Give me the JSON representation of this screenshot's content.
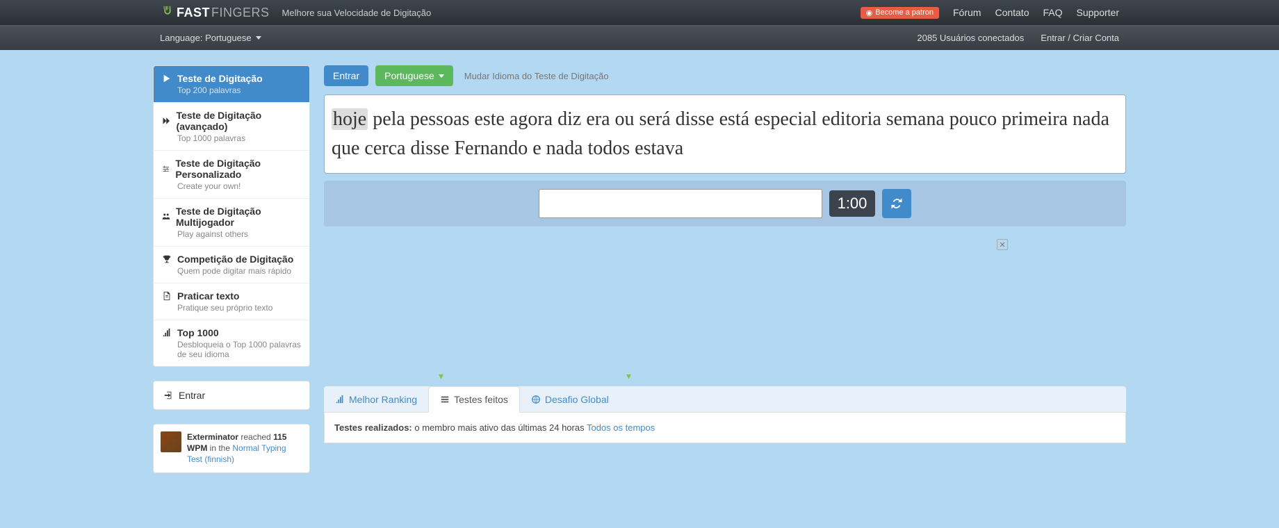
{
  "header": {
    "logo_bold": "FAST",
    "logo_thin": "FINGERS",
    "tagline": "Melhore sua Velocidade de Digitação",
    "patron": "Become a patron",
    "nav": {
      "forum": "Fórum",
      "contato": "Contato",
      "faq": "FAQ",
      "supporter": "Supporter"
    }
  },
  "subheader": {
    "language_label": "Language: Portuguese",
    "users_online": "2085 Usuários conectados",
    "login": "Entrar / Criar Conta"
  },
  "sidebar": {
    "items": [
      {
        "title": "Teste de Digitação",
        "sub": "Top 200 palavras"
      },
      {
        "title": "Teste de Digitação (avançado)",
        "sub": "Top 1000 palavras"
      },
      {
        "title": "Teste de Digitação Personalizado",
        "sub": "Create your own!"
      },
      {
        "title": "Teste de Digitação Multijogador",
        "sub": "Play against others"
      },
      {
        "title": "Competição de Digitação",
        "sub": "Quem pode digitar mais rápido"
      },
      {
        "title": "Praticar texto",
        "sub": "Pratique seu próprio texto"
      },
      {
        "title": "Top 1000",
        "sub": "Desbloqueia o Top 1000 palavras de seu idioma"
      }
    ],
    "login": "Entrar"
  },
  "achievement": {
    "user": "Exterminator",
    "reached": " reached ",
    "wpm": "115 WPM",
    "in_the": " in the ",
    "link": "Normal Typing Test (finnish)"
  },
  "toprow": {
    "login_btn": "Entrar",
    "lang_btn": "Portuguese",
    "hint": "Mudar Idioma do Teste de Digitação"
  },
  "typing": {
    "highlight_word": "hoje",
    "rest_words": " pela pessoas este agora diz era ou será disse está especial editoria semana pouco primeira nada que cerca disse Fernando e nada todos estava",
    "timer": "1:00"
  },
  "tabs": {
    "t1": "Melhor Ranking",
    "t2": "Testes feitos",
    "t3": "Desafio Global"
  },
  "panel": {
    "label": "Testes realizados:",
    "text": " o membro mais ativo das últimas 24 horas ",
    "link": "Todos os tempos"
  }
}
